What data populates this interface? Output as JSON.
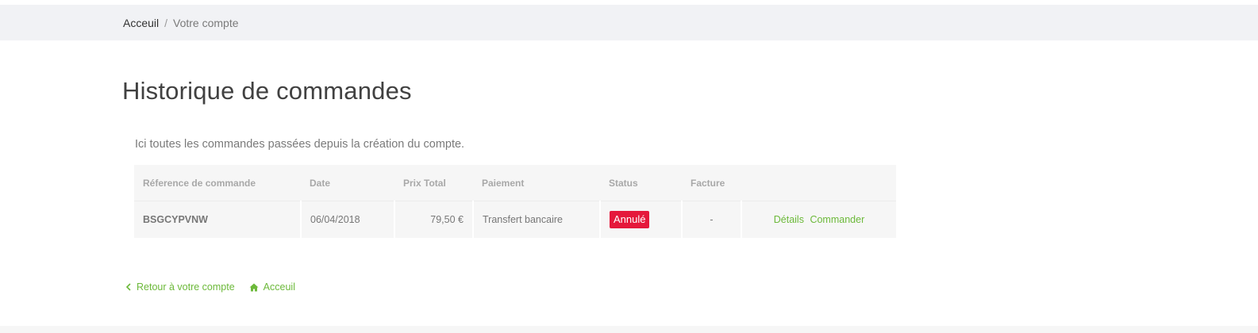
{
  "breadcrumb": {
    "home": "Acceuil",
    "separator": "/",
    "current": "Votre compte"
  },
  "page": {
    "title": "Historique de commandes",
    "intro": "Ici toutes les commandes passées depuis la création du compte."
  },
  "table": {
    "headers": [
      "Réference de commande",
      "Date",
      "Prix Total",
      "Paiement",
      "Status",
      "Facture",
      ""
    ],
    "rows": [
      {
        "reference": "BSGCYPVNW",
        "date": "06/04/2018",
        "total": "79,50 €",
        "payment": "Transfert bancaire",
        "status": "Annulé",
        "invoice": "-",
        "details_label": "Détails",
        "reorder_label": "Commander"
      }
    ]
  },
  "footer": {
    "back_label": "Retour à votre compte",
    "home_label": "Acceuil"
  },
  "colors": {
    "link": "#6cb93a",
    "status_cancelled": "#e5183b",
    "breadcrumb_bg": "#f1f2f5",
    "table_bg": "#f6f6f6"
  },
  "icons": {
    "back": "chevron-left-icon",
    "home": "home-icon"
  }
}
